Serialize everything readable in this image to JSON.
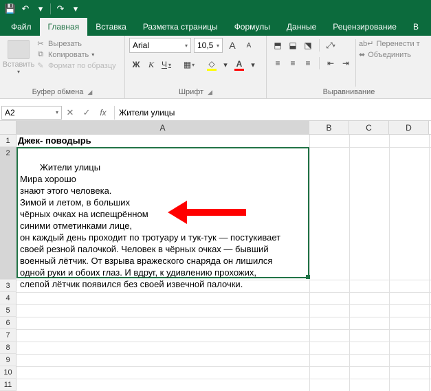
{
  "qat": {
    "save": "💾",
    "undo": "↶",
    "redo": "↷",
    "more": "▾"
  },
  "tabs": {
    "file": "Файл",
    "home": "Главная",
    "insert": "Вставка",
    "pagelayout": "Разметка страницы",
    "formulas": "Формулы",
    "data": "Данные",
    "review": "Рецензирование"
  },
  "clipboard": {
    "paste": "Вставить",
    "cut": "Вырезать",
    "copy": "Копировать",
    "format_painter": "Формат по образцу",
    "group_label": "Буфер обмена"
  },
  "font": {
    "name": "Arial",
    "size": "10,5",
    "grow": "A",
    "shrink": "A",
    "bold": "Ж",
    "italic": "К",
    "underline": "Ч",
    "group_label": "Шрифт"
  },
  "alignment": {
    "wrap": "Перенести т",
    "merge": "Объединить",
    "group_label": "Выравнивание"
  },
  "namebox": "A2",
  "formula_text": "Жители улицы",
  "colA": "A",
  "colB": "B",
  "colC": "C",
  "colD": "D",
  "cell_a1": "Джек- поводырь",
  "cell_a2_text": "Жители улицы\nМира хорошо\nзнают этого человека.\nЗимой и летом, в больших\nчёрных очках на испещрённом\nсиними отметинками лице,\nон каждый день проходит по тротуару и тук-тук — постукивает\nсвоей резной палочкой. Человек в чёрных очках — бывший\nвоенный лётчик. От взрыва вражеского снаряда он лишился\nодной руки и обоих глаз. И вдруг, к удивлению прохожих,\nслепой лётчик появился без своей извечной палочки.",
  "chart_data": null
}
